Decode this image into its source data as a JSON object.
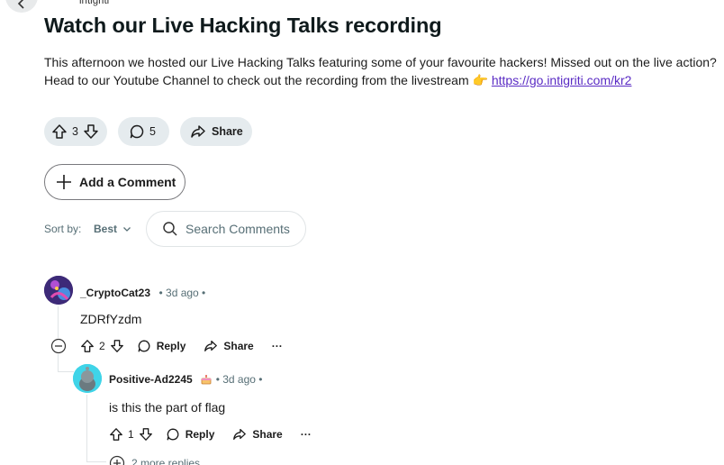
{
  "post": {
    "author": "intigriti",
    "title": "Watch our Live Hacking Talks recording",
    "body_line1": "This afternoon we hosted our Live Hacking Talks featuring some of your favourite hackers! Missed out on the live action?",
    "body_line2": "Head to our Youtube Channel to check out the recording from the livestream 👉 ",
    "link": "https://go.intigriti.com/kr2",
    "votes": "3",
    "comments": "5",
    "share_label": "Share"
  },
  "add_comment_label": "Add a Comment",
  "sort": {
    "label": "Sort by:",
    "value": "Best"
  },
  "search": {
    "placeholder": "Search Comments"
  },
  "comments": [
    {
      "user": "_CryptoCat23",
      "time": "• 3d ago •",
      "text": "ZDRfYzdm",
      "votes": "2",
      "reply_label": "Reply",
      "share_label": "Share",
      "more": "···"
    },
    {
      "user": "Positive-Ad2245",
      "time": "• 3d ago •",
      "text": "is this the part of flag",
      "votes": "1",
      "reply_label": "Reply",
      "share_label": "Share",
      "more": "···"
    }
  ],
  "more_replies": "2 more replies",
  "colors": {
    "link": "#5a2bc4",
    "pill_bg": "#e5ebee",
    "meta": "#576f76"
  }
}
